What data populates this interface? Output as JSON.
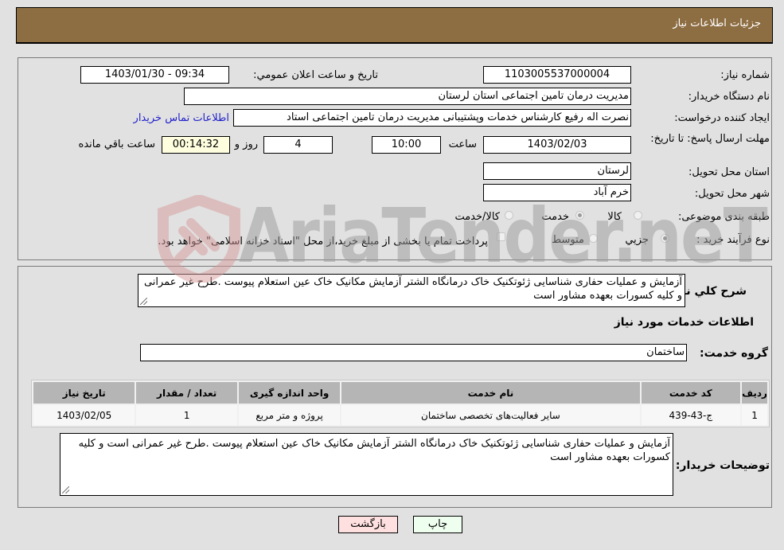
{
  "header": {
    "title": "جزئیات اطلاعات نیاز"
  },
  "details": {
    "need_number": {
      "label": "شماره نیاز:",
      "value": "1103005537000004"
    },
    "announce_datetime": {
      "label": "تاریخ و ساعت اعلان عمومي:",
      "value": "1403/01/30 - 09:34"
    },
    "buyer_org": {
      "label": "نام دستگاه خریدار:",
      "value": "مدیریت درمان تامین اجتماعی استان لرستان"
    },
    "requester": {
      "label": "ایجاد کننده درخواست:",
      "value": "نصرت اله رفیع کارشناس خدمات وپشتیبانی مدیریت درمان تامین اجتماعی استاد",
      "contact_link": "اطلاعات تماس خریدار"
    },
    "deadline": {
      "label": "مهلت ارسال پاسخ: تا تاریخ:",
      "date": "1403/02/03",
      "time_label": "ساعت",
      "time": "10:00",
      "days": "4",
      "days_label": "روز و",
      "remaining": "00:14:32",
      "remaining_label": "ساعت باقي مانده"
    },
    "delivery_province": {
      "label": "استان محل تحویل:",
      "value": "لرستان"
    },
    "delivery_city": {
      "label": "شهر محل تحویل:",
      "value": "خرم آباد"
    },
    "category": {
      "label": "طبقه بندی موضوعی:",
      "options": [
        "کالا",
        "خدمت",
        "کالا/خدمت"
      ],
      "selected": "خدمت"
    },
    "purchase_type": {
      "label": "نوع فرآیند خرید :",
      "options": [
        "جزيي",
        "متوسط"
      ],
      "selected": "جزيي",
      "treasury_note": "پرداخت تمام یا بخشی از مبلغ خرید،از محل \"اسناد خزانه اسلامی\" خواهد بود."
    }
  },
  "summary": {
    "label": "شرح کلي نیاز:",
    "value": "آزمایش و عملیات حفاری شناسایی ژئوتکنیک خاک درمانگاه الشتر آزمایش مکانیک خاک  عین استعلام پیوست .طرح غیر عمرانی و کلیه کسورات بعهده مشاور است"
  },
  "services": {
    "section_title": "اطلاعات خدمات مورد نیاز",
    "group_label": "گروه خدمت:",
    "group_value": "ساختمان",
    "columns": [
      "ردیف",
      "کد خدمت",
      "نام خدمت",
      "واحد اندازه گیری",
      "تعداد / مقدار",
      "تاریخ نیاز"
    ],
    "rows": [
      [
        "1",
        "ج-43-439",
        "سایر فعالیت‌های تخصصی ساختمان",
        "پروژه و متر مربع",
        "1",
        "1403/02/05"
      ]
    ]
  },
  "buyer_notes": {
    "label": "توضیحات خریدار:",
    "value": "آزمایش و عملیات حفاری شناسایی ژئوتکنیک خاک درمانگاه الشتر آزمایش مکانیک خاک  عین استعلام پیوست .طرح غیر عمرانی است  و کلیه کسورات بعهده مشاور است"
  },
  "buttons": {
    "print": "چاپ",
    "back": "بازگشت"
  },
  "watermark": {
    "text": "AriaTender.neT"
  },
  "colors": {
    "header_bg": "#8d6d42",
    "print_bg": "#efffef",
    "back_bg": "#ffe0e0",
    "remaining_bg": "#ffffe0",
    "link": "#2222cc"
  }
}
